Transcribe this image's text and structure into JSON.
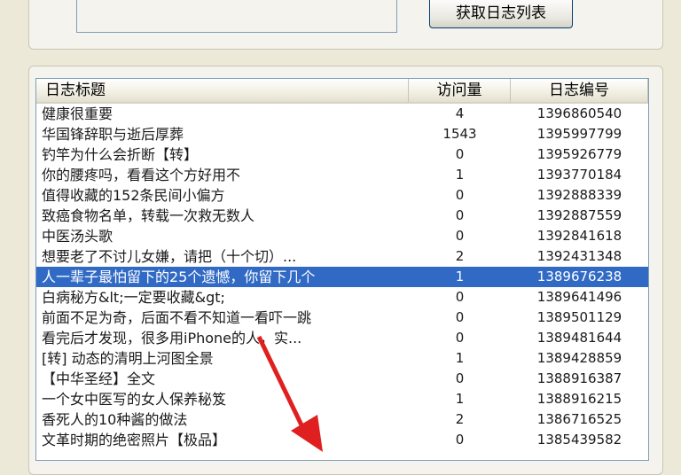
{
  "toolbar": {
    "fetch_label": "获取日志列表"
  },
  "list": {
    "columns": {
      "title": "日志标题",
      "visits": "访问量",
      "id": "日志编号"
    },
    "selected_index": 8,
    "rows": [
      {
        "title": "健康很重要",
        "visits": "4",
        "id": "1396860540"
      },
      {
        "title": "华国锋辞职与逝后厚葬",
        "visits": "1543",
        "id": "1395997799"
      },
      {
        "title": "钓竿为什么会折断【转】",
        "visits": "0",
        "id": "1395926779"
      },
      {
        "title": "你的腰疼吗，看看这个方好用不",
        "visits": "1",
        "id": "1393770184"
      },
      {
        "title": "值得收藏的152条民间小偏方",
        "visits": "0",
        "id": "1392888339"
      },
      {
        "title": "致癌食物名单，转载一次救无数人",
        "visits": "0",
        "id": "1392887559"
      },
      {
        "title": "中医汤头歌",
        "visits": "0",
        "id": "1392841618"
      },
      {
        "title": "想要老了不讨儿女嫌，请把（十个切）...",
        "visits": "2",
        "id": "1392431348"
      },
      {
        "title": "人一辈子最怕留下的25个遗憾，你留下几个",
        "visits": "1",
        "id": "1389676238"
      },
      {
        "title": "白病秘方&lt;一定要收藏&gt;",
        "visits": "0",
        "id": "1389641496"
      },
      {
        "title": "前面不足为奇，后面不看不知道一看吓一跳",
        "visits": "0",
        "id": "1389501129"
      },
      {
        "title": "看完后才发现，很多用iPhone的人，实...",
        "visits": "0",
        "id": "1389481644"
      },
      {
        "title": "[转] 动态的清明上河图全景",
        "visits": "1",
        "id": "1389428859"
      },
      {
        "title": "【中华圣经】全文",
        "visits": "0",
        "id": "1388916387"
      },
      {
        "title": "一个女中医写的女人保养秘笈",
        "visits": "1",
        "id": "1388916215"
      },
      {
        "title": "香死人的10种酱的做法",
        "visits": "2",
        "id": "1386716525"
      },
      {
        "title": "文革时期的绝密照片【极品】",
        "visits": "0",
        "id": "1385439582"
      }
    ]
  },
  "annotation": {
    "arrow_color": "#e02020"
  }
}
